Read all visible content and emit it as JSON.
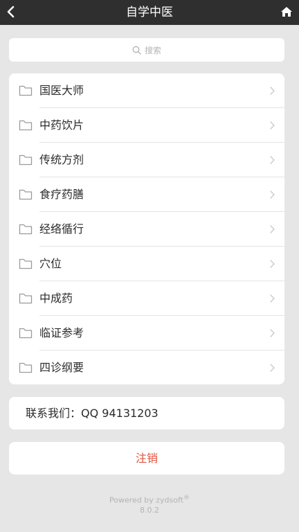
{
  "header": {
    "title": "自学中医",
    "back_icon": "chevron-left-icon",
    "home_icon": "home-icon"
  },
  "search": {
    "placeholder": "搜索",
    "icon": "search-icon"
  },
  "menu": {
    "items": [
      {
        "label": "国医大师",
        "icon": "folder-icon"
      },
      {
        "label": "中药饮片",
        "icon": "folder-icon"
      },
      {
        "label": "传统方剂",
        "icon": "folder-icon"
      },
      {
        "label": "食疗药膳",
        "icon": "folder-icon"
      },
      {
        "label": "经络循行",
        "icon": "folder-icon"
      },
      {
        "label": "穴位",
        "icon": "folder-icon"
      },
      {
        "label": "中成药",
        "icon": "folder-icon"
      },
      {
        "label": "临证参考",
        "icon": "folder-icon"
      },
      {
        "label": "四诊纲要",
        "icon": "folder-icon"
      }
    ]
  },
  "contact": {
    "text": "联系我们：QQ 94131203"
  },
  "logout": {
    "label": "注销"
  },
  "footer": {
    "powered": "Powered by zydsoft",
    "registered": "®",
    "version": "8.0.2"
  },
  "colors": {
    "header_bg": "#2f2f2f",
    "page_bg": "#e6e6e6",
    "logout_text": "#e0533f"
  }
}
